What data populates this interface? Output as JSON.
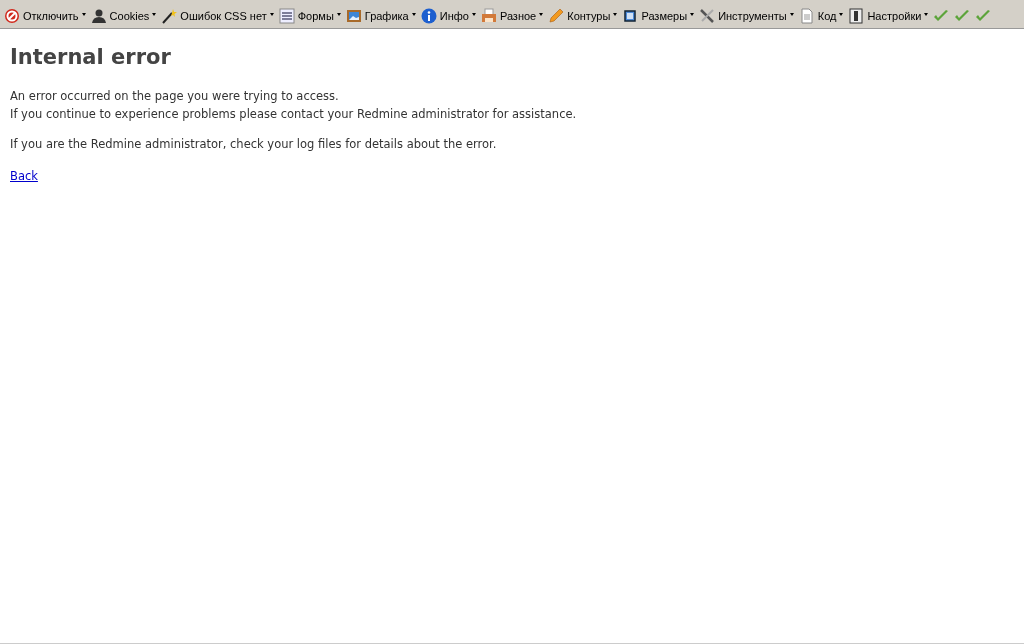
{
  "toolbar": {
    "items": [
      {
        "kind": "forbidden",
        "label": "Отключить",
        "dropdown": true
      },
      {
        "kind": "person",
        "label": "Cookies",
        "dropdown": true
      },
      {
        "kind": "wand",
        "label": "Ошибок CSS нет",
        "dropdown": true
      },
      {
        "kind": "form",
        "label": "Формы",
        "dropdown": true
      },
      {
        "kind": "picture",
        "label": "Графика",
        "dropdown": true
      },
      {
        "kind": "info",
        "label": "Инфо",
        "dropdown": true
      },
      {
        "kind": "printer",
        "label": "Разное",
        "dropdown": true
      },
      {
        "kind": "pencil",
        "label": "Контуры",
        "dropdown": true
      },
      {
        "kind": "crop",
        "label": "Размеры",
        "dropdown": true
      },
      {
        "kind": "tools",
        "label": "Инструменты",
        "dropdown": true
      },
      {
        "kind": "document",
        "label": "Код",
        "dropdown": true
      },
      {
        "kind": "settings",
        "label": "Настройки",
        "dropdown": true
      },
      {
        "kind": "check"
      },
      {
        "kind": "check"
      },
      {
        "kind": "check"
      }
    ]
  },
  "page": {
    "title": "Internal error",
    "paragraphs": [
      [
        "An error occurred on the page you were trying to access.",
        "If you continue to experience problems please contact your Redmine administrator for assistance."
      ],
      [
        "If you are the Redmine administrator, check your log files for details about the error."
      ]
    ],
    "link": "Back"
  }
}
